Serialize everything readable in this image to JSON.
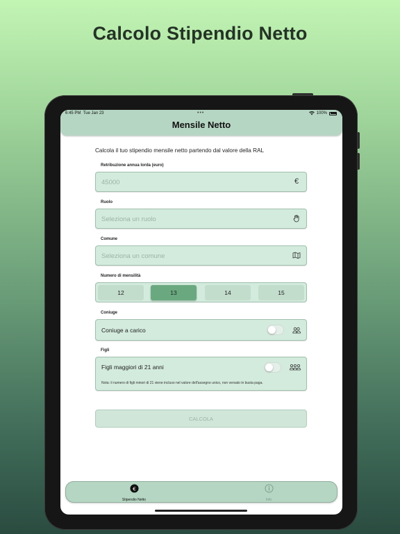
{
  "headline": "Calcolo Stipendio Netto",
  "status": {
    "time": "6:45 PM",
    "date": "Tue Jan 23",
    "battery": "100%",
    "dots": "•••"
  },
  "navbar": {
    "title": "Mensile Netto"
  },
  "intro": "Calcola il tuo stipendio mensile netto partendo dal valore della RAL",
  "ral": {
    "label": "Retribuzione annua lorda (euro)",
    "placeholder": "45000",
    "icon": "euro-icon",
    "symbol": "€"
  },
  "ruolo": {
    "label": "Ruolo",
    "placeholder": "Seleziona un ruolo",
    "icon": "hand-icon"
  },
  "comune": {
    "label": "Comune",
    "placeholder": "Seleziona un comune",
    "icon": "map-icon"
  },
  "mensilita": {
    "label": "Numero di mensilità",
    "options": [
      "12",
      "13",
      "14",
      "15"
    ],
    "selected": "13"
  },
  "coniuge": {
    "label": "Coniuge",
    "toggle_label": "Coniuge a carico",
    "checked": false,
    "icon": "two-people-icon"
  },
  "figli": {
    "label": "Figli",
    "toggle_label": "Figli maggiori di 21 anni",
    "checked": false,
    "icon": "three-people-icon",
    "note": "Nota: il numero di figli minori di 21 viene incluso nel valore dell'assegno unico, non versato in busta paga."
  },
  "calcola_label": "CALCOLA",
  "tabs": [
    {
      "label": "Stipendio Netto",
      "icon": "euro-circle-icon",
      "active": true
    },
    {
      "label": "Info",
      "icon": "info-circle-icon",
      "active": false
    }
  ],
  "colors": {
    "accent": "#6aa97f",
    "bar": "#b5d6c2",
    "field": "#d3ebdd"
  }
}
